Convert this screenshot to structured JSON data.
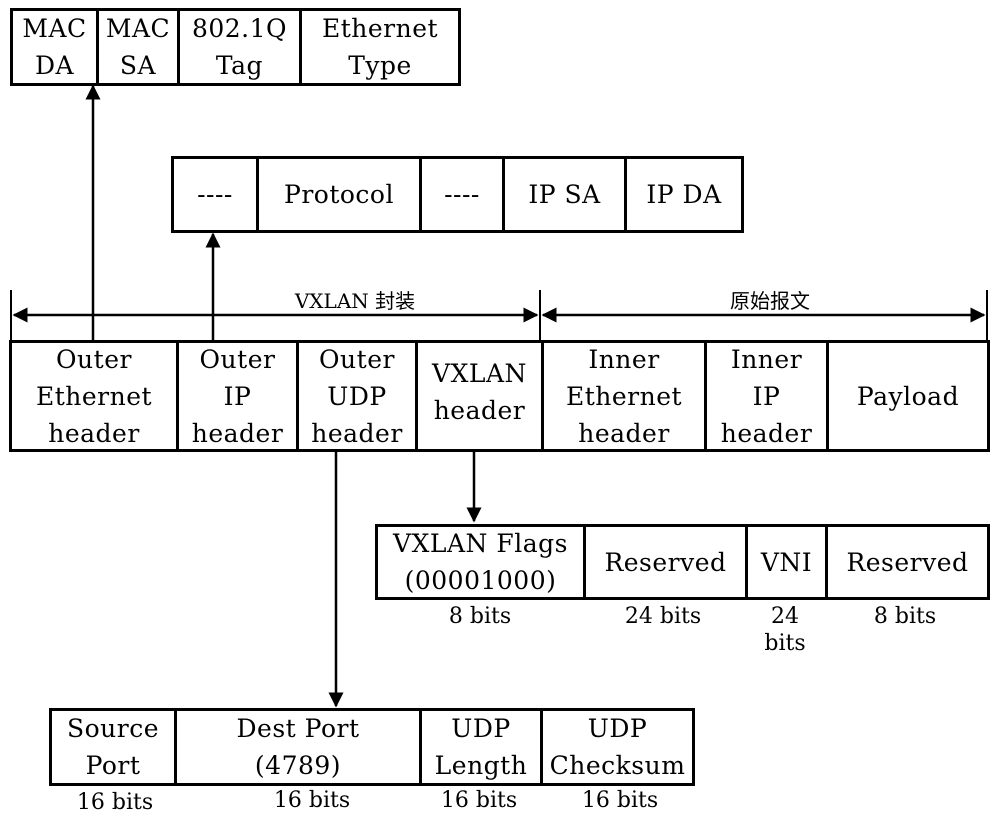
{
  "ethernet_header_fields": [
    "MAC\nDA",
    "MAC\nSA",
    "802.1Q\nTag",
    "Ethernet\nType"
  ],
  "ip_header_fields": [
    "----",
    "Protocol",
    "----",
    "IP SA",
    "IP DA"
  ],
  "span_labels": {
    "vxlan_encap": "VXLAN 封装",
    "original_packet": "原始报文"
  },
  "packet_fields": [
    "Outer\nEthernet\nheader",
    "Outer\nIP\nheader",
    "Outer\nUDP\nheader",
    "VXLAN\nheader",
    "Inner\nEthernet\nheader",
    "Inner\nIP\nheader",
    "Payload"
  ],
  "vxlan_header_fields": [
    {
      "name": "VXLAN Flags\n(00001000)",
      "size": "8 bits"
    },
    {
      "name": "Reserved",
      "size": "24 bits"
    },
    {
      "name": "VNI",
      "size": "24\nbits"
    },
    {
      "name": "Reserved",
      "size": "8 bits"
    }
  ],
  "udp_header_fields": [
    {
      "name": "Source\nPort",
      "size": "16 bits"
    },
    {
      "name": "Dest Port\n(4789)",
      "size": "16 bits"
    },
    {
      "name": "UDP\nLength",
      "size": "16 bits"
    },
    {
      "name": "UDP\nChecksum",
      "size": "16 bits"
    }
  ]
}
